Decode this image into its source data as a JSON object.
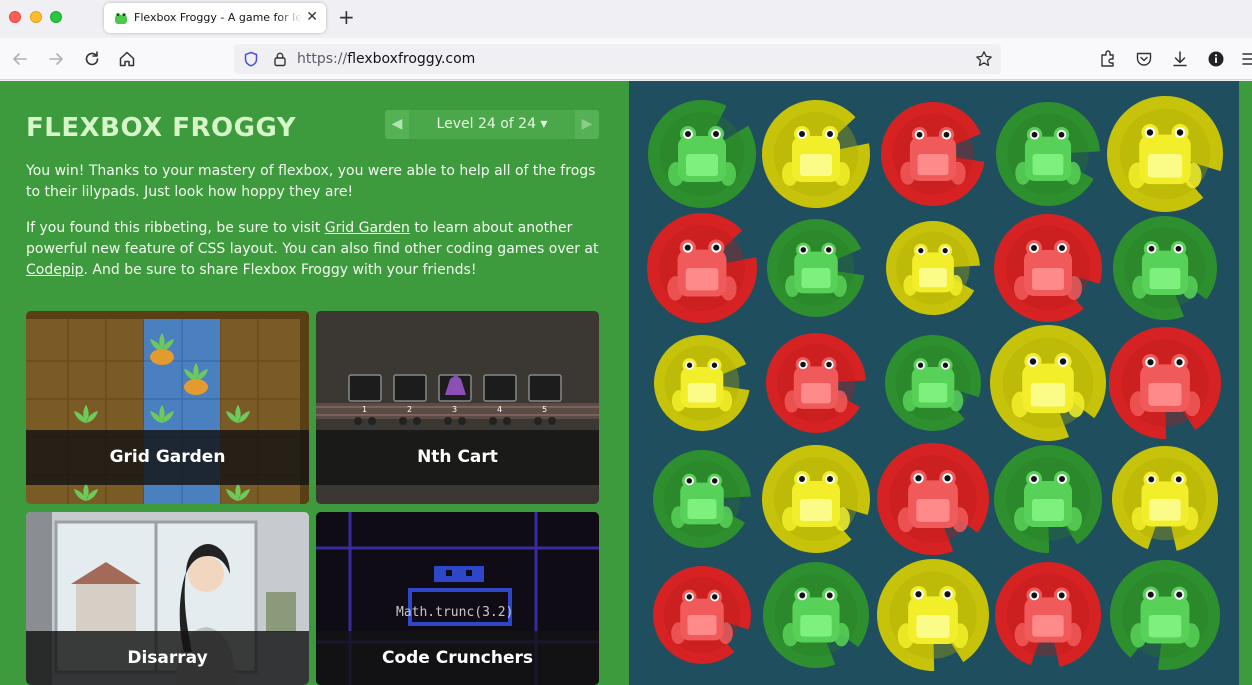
{
  "browser": {
    "tab_title": "Flexbox Froggy - A game for learning CSS flexbox",
    "url_scheme": "https://",
    "url_host": "flexboxfroggy.com",
    "new_tab": "+",
    "close": "✕"
  },
  "game": {
    "logo": "FLEXBOX FROGGY",
    "level_label": "Level 24 of 24 ▾",
    "win_text": "You win! Thanks to your mastery of flexbox, you were able to help all of the frogs to their lilypads. Just look how hoppy they are!",
    "promo_before": "If you found this ribbeting, be sure to visit ",
    "promo_link1": "Grid Garden",
    "promo_middle": " to learn about another powerful new feature of CSS layout. You can also find other coding games over at ",
    "promo_link2": "Codepip",
    "promo_after": ". And be sure to share Flexbox Froggy with your friends!",
    "cards": [
      {
        "label": "Grid Garden"
      },
      {
        "label": "Nth Cart"
      },
      {
        "label": "Disarray"
      },
      {
        "label": "Code Crunchers"
      }
    ],
    "cart_numbers": [
      "1",
      "2",
      "3",
      "4",
      "5"
    ],
    "cruncher_code": "Math.trunc(3.2)"
  },
  "board": {
    "colors": {
      "green": "#2e8f2e",
      "yellow": "#c7c20a",
      "red": "#d62222",
      "background": "#1f4e5f"
    },
    "grid": [
      [
        "green",
        "yellow",
        "red",
        "green",
        "yellow"
      ],
      [
        "red",
        "green",
        "yellow",
        "red",
        "green"
      ],
      [
        "yellow",
        "red",
        "green",
        "yellow",
        "red"
      ],
      [
        "green",
        "yellow",
        "red",
        "green",
        "yellow"
      ],
      [
        "red",
        "green",
        "yellow",
        "red",
        "green"
      ]
    ]
  }
}
